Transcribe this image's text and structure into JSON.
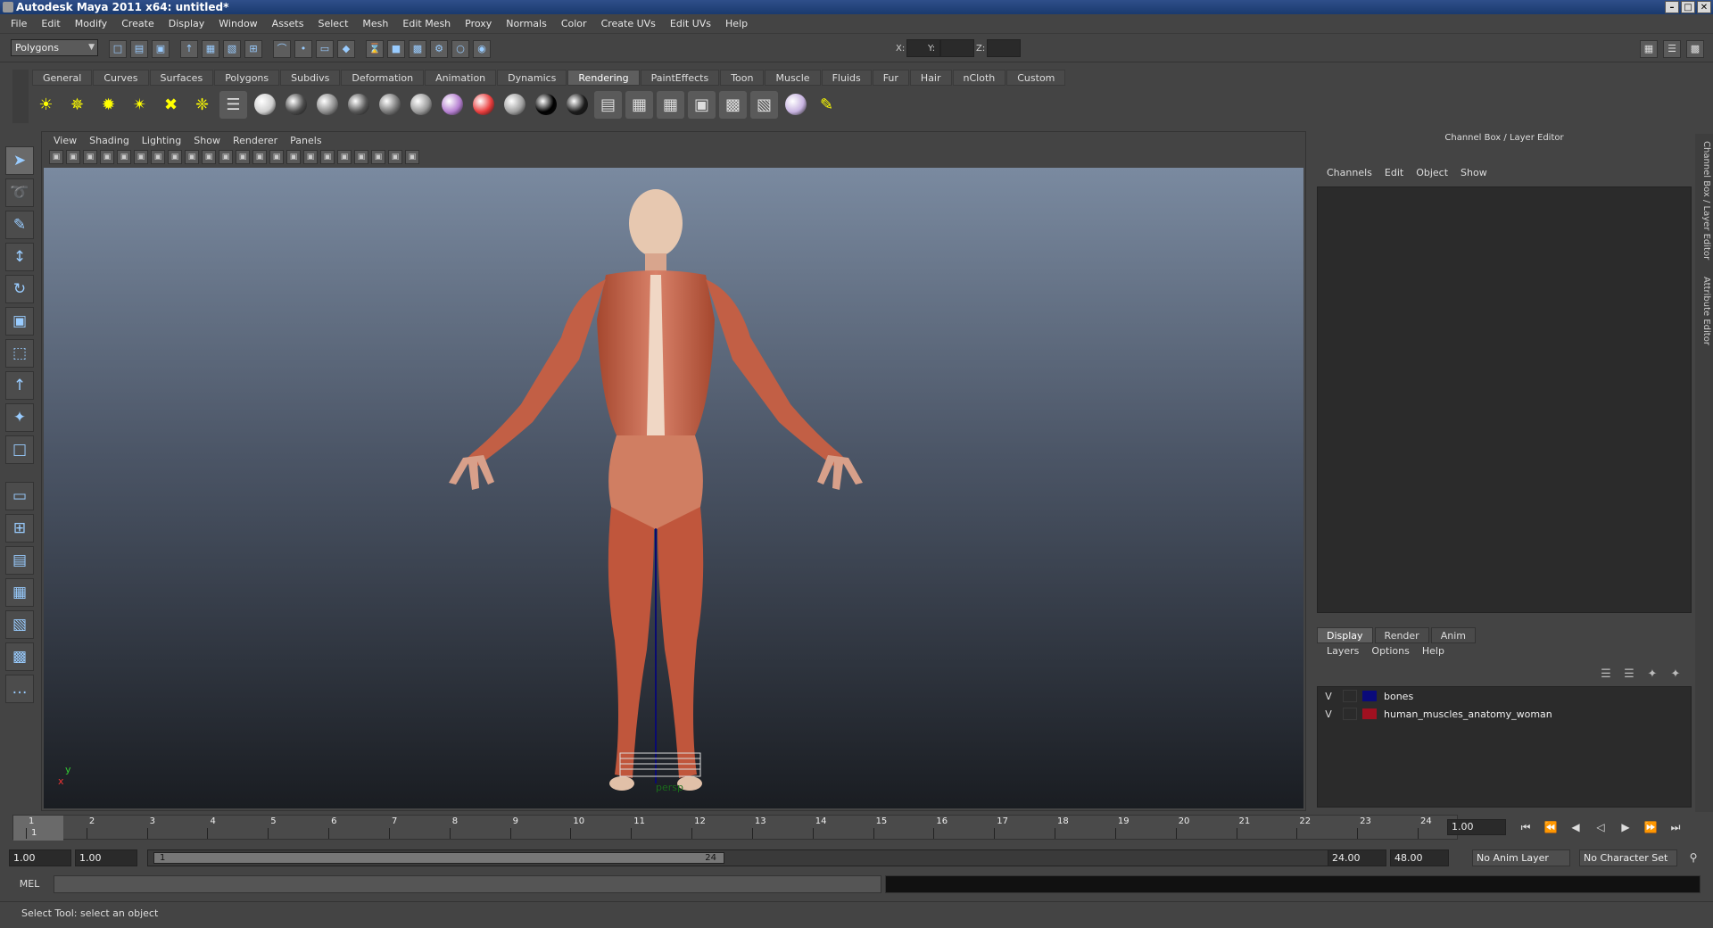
{
  "window": {
    "title": "Autodesk Maya 2011 x64: untitled*",
    "controls": [
      "–",
      "□",
      "✕"
    ]
  },
  "menubar": [
    "File",
    "Edit",
    "Modify",
    "Create",
    "Display",
    "Window",
    "Assets",
    "Select",
    "Mesh",
    "Edit Mesh",
    "Proxy",
    "Normals",
    "Color",
    "Create UVs",
    "Edit UVs",
    "Help"
  ],
  "status_line": {
    "mode": "Polygons",
    "coords": {
      "x_label": "X:",
      "y_label": "Y:",
      "z_label": "Z:"
    },
    "icons": [
      "new-scene",
      "open-scene",
      "save-scene",
      "select-hierarchy",
      "select-object",
      "select-component",
      "snap-grid",
      "snap-curve",
      "snap-point",
      "snap-plane",
      "make-live",
      "history",
      "render-frame",
      "ipr-render",
      "render-settings",
      "hypershade",
      "render-view"
    ]
  },
  "shelf": {
    "tabs": [
      "General",
      "Curves",
      "Surfaces",
      "Polygons",
      "Subdivs",
      "Deformation",
      "Animation",
      "Dynamics",
      "Rendering",
      "PaintEffects",
      "Toon",
      "Muscle",
      "Fluids",
      "Fur",
      "Hair",
      "nCloth",
      "Custom"
    ],
    "active_tab": "Rendering",
    "icons": [
      {
        "name": "ambient-light-icon",
        "glyph": "☀"
      },
      {
        "name": "directional-light-icon",
        "glyph": "✵"
      },
      {
        "name": "point-light-icon",
        "glyph": "✹"
      },
      {
        "name": "spot-light-icon",
        "glyph": "✴"
      },
      {
        "name": "area-light-icon",
        "glyph": "✖"
      },
      {
        "name": "volume-light-icon",
        "glyph": "❈"
      },
      {
        "name": "camera-icon",
        "glyph": "☰"
      },
      {
        "name": "sphere-lambert-icon",
        "color": "#cfcfcf"
      },
      {
        "name": "sphere-blinn-icon",
        "color": "#4a4a4a"
      },
      {
        "name": "sphere-phong-icon",
        "color": "#8c8c8c"
      },
      {
        "name": "sphere-phonge-icon",
        "color": "#555555"
      },
      {
        "name": "sphere-aniso-icon",
        "color": "#777777"
      },
      {
        "name": "sphere-layered-icon",
        "color": "#999999"
      },
      {
        "name": "sphere-ramp-icon",
        "color": "#b57fd1"
      },
      {
        "name": "sphere-rainbow-icon",
        "color": "#e83c3c"
      },
      {
        "name": "sphere-grey-icon",
        "color": "#a0a0a0"
      },
      {
        "name": "sphere-black-icon",
        "color": "#000000"
      },
      {
        "name": "sphere-surface-icon",
        "color": "#1b1b1b"
      },
      {
        "name": "texture-file-icon",
        "glyph": "▤"
      },
      {
        "name": "texture-ramp-icon",
        "glyph": "▦"
      },
      {
        "name": "texture-grid-icon",
        "glyph": "▦"
      },
      {
        "name": "texture-env-icon",
        "glyph": "▣"
      },
      {
        "name": "texture-layered-icon",
        "glyph": "▩"
      },
      {
        "name": "render-node-icon",
        "glyph": "▧"
      },
      {
        "name": "render-sphere-icon",
        "color": "#c7b3e0"
      },
      {
        "name": "paint-brush-icon",
        "glyph": "✎"
      }
    ]
  },
  "toolbox": [
    "select-tool-icon",
    "lasso-tool-icon",
    "paint-select-icon",
    "move-tool-icon",
    "rotate-tool-icon",
    "scale-tool-icon",
    "universal-manip-icon",
    "soft-mod-icon",
    "show-manip-icon",
    "last-tool-icon",
    "layout-single-icon",
    "layout-four-icon",
    "layout-outliner-icon",
    "layout-graph-icon",
    "layout-hypershade-icon",
    "layout-persp-icon",
    "layout-extra-icon"
  ],
  "panel": {
    "menus": [
      "View",
      "Shading",
      "Lighting",
      "Show",
      "Renderer",
      "Panels"
    ],
    "camera_label": "persp",
    "axis": {
      "y": "y",
      "x": "x"
    }
  },
  "channel_box": {
    "title": "Channel Box / Layer Editor",
    "menus": [
      "Channels",
      "Edit",
      "Object",
      "Show"
    ]
  },
  "layer_editor": {
    "tabs": [
      "Display",
      "Render",
      "Anim"
    ],
    "active_tab": "Display",
    "menus": [
      "Layers",
      "Options",
      "Help"
    ],
    "layers": [
      {
        "visible": "V",
        "name": "bones",
        "color": "#0a0a7a"
      },
      {
        "visible": "V",
        "name": "human_muscles_anatomy_woman",
        "color": "#a01020"
      }
    ]
  },
  "side_tabs": [
    "Channel Box / Layer Editor",
    "Attribute Editor"
  ],
  "time_slider": {
    "ticks": [
      "1",
      "2",
      "3",
      "4",
      "5",
      "6",
      "7",
      "8",
      "9",
      "10",
      "11",
      "12",
      "13",
      "14",
      "15",
      "16",
      "17",
      "18",
      "19",
      "20",
      "21",
      "22",
      "23",
      "24"
    ],
    "current_frame": "1",
    "current_frame_field": "1.00"
  },
  "range": {
    "start_time": "1.00",
    "playback_start": "1.00",
    "range_start_label": "1",
    "range_end_label": "24",
    "playback_end": "24.00",
    "end_time": "48.00",
    "anim_layer": "No Anim Layer",
    "character_set": "No Character Set"
  },
  "command_line": {
    "label": "MEL"
  },
  "help_line": "Select Tool: select an object"
}
